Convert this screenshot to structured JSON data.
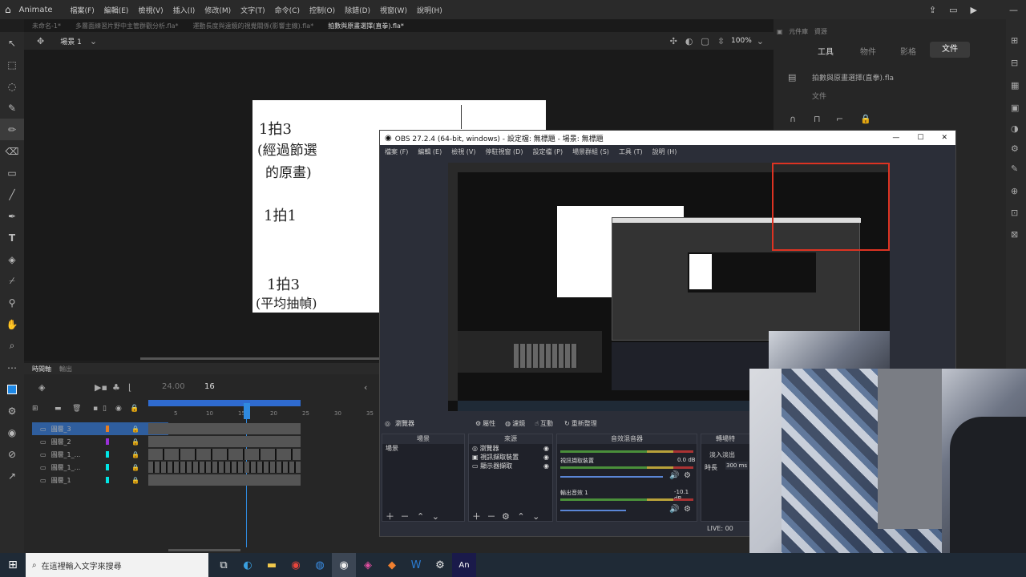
{
  "app": {
    "name": "Animate"
  },
  "menu": [
    "檔案(F)",
    "編輯(E)",
    "檢視(V)",
    "插入(I)",
    "修改(M)",
    "文字(T)",
    "命令(C)",
    "控制(O)",
    "除錯(D)",
    "視窗(W)",
    "說明(H)"
  ],
  "tabs": [
    "未命名-1*",
    "多層面練習片野中主管群觀分析.fla*",
    "運動長度與遠鏡的視覺關係(影響主線).fla*",
    "拍數與原畫選擇(直拳).fla*"
  ],
  "scene": {
    "label": "場景 1",
    "zoom": "100%"
  },
  "canvas": {
    "text1": "1拍3",
    "text2": "(經過節選",
    "text3": "的原畫)",
    "text4": "1拍1",
    "text5": "1拍3",
    "text6": "(平均抽幀)"
  },
  "right_panel": {
    "tabs": [
      "工具",
      "物件",
      "影格",
      "文件"
    ],
    "doc_name": "拍數與原畫選擇(直拳).fla",
    "doc_label": "文件"
  },
  "timeline": {
    "header_tabs": [
      "時間軸",
      "輸出"
    ],
    "fps": "24.00",
    "frame": "16",
    "ruler": [
      "5",
      "10",
      "15",
      "20",
      "25",
      "30",
      "35"
    ],
    "layers": [
      "圖層_3",
      "圖層_2",
      "圖層_1_...",
      "圖層_1_...",
      "圖層_1"
    ],
    "layer_colors": [
      "#e67e22",
      "#9b30d9",
      "#00e5e5",
      "#00e5e5",
      "#00e5e5"
    ]
  },
  "obs": {
    "title": "OBS 27.2.4 (64-bit, windows) - 設定檔: 無標題 - 場景: 無標題",
    "menu": [
      "檔案 (F)",
      "編輯 (E)",
      "檢視 (V)",
      "停駐視窗 (D)",
      "設定檔 (P)",
      "場景群組 (S)",
      "工具 (T)",
      "說明 (H)"
    ],
    "controls": [
      "瀏覽器",
      "屬性",
      "濾鏡",
      "互動",
      "重新整理"
    ],
    "docks": {
      "scenes_title": "場景",
      "scene_item": "場景",
      "sources_title": "來源",
      "sources": [
        "瀏覽器",
        "視訊擷取裝置",
        "顯示器擷取"
      ],
      "mixer_title": "音效混音器",
      "mixer": [
        {
          "name": "視訊擷取裝置",
          "db": "0.0 dB"
        },
        {
          "name": "輸出音效 1",
          "db": "-10.1 dB"
        }
      ],
      "transitions_title": "轉場特",
      "transition_item": "淡入淡出",
      "duration_label": "時長",
      "duration": "300 ms",
      "status": "LIVE: 00"
    }
  },
  "taskbar": {
    "search_placeholder": "在這裡輸入文字來搜尋"
  }
}
